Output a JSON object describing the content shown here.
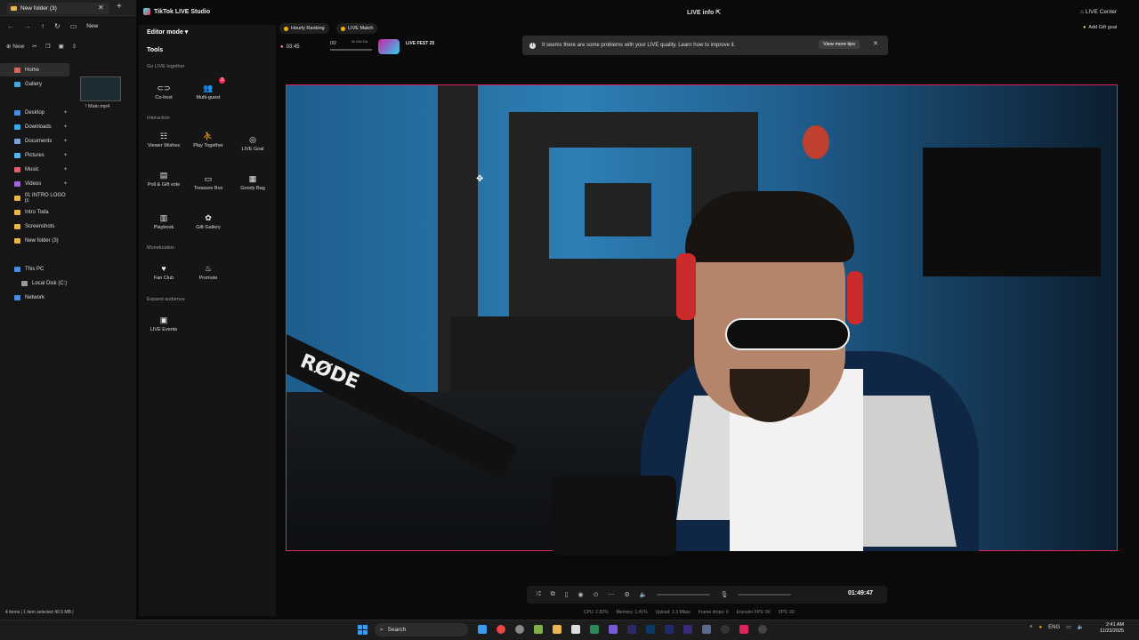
{
  "explorer": {
    "tab_title": "New folder (3)",
    "new_label": "New",
    "sidebar": [
      {
        "label": "Home",
        "color": "#cf6a5a"
      },
      {
        "label": "Gallery",
        "color": "#4aa3df"
      },
      {
        "label": "Desktop",
        "color": "#4a8de0"
      },
      {
        "label": "Downloads",
        "color": "#3fa9e8"
      },
      {
        "label": "Documents",
        "color": "#7aa4d9"
      },
      {
        "label": "Pictures",
        "color": "#59b5e8"
      },
      {
        "label": "Music",
        "color": "#e06070"
      },
      {
        "label": "Videos",
        "color": "#a066d9"
      },
      {
        "label": "01 INTRO LOGO (c",
        "color": "#e8b64c"
      },
      {
        "label": "Intro Toda",
        "color": "#e8b64c"
      },
      {
        "label": "Screenshots",
        "color": "#e8b64c"
      },
      {
        "label": "New folder (3)",
        "color": "#e8b64c"
      },
      {
        "label": "This PC",
        "color": "#4a8de0"
      },
      {
        "label": "Local Disk (C:)",
        "color": "#999999"
      },
      {
        "label": "Network",
        "color": "#4a8de0"
      }
    ],
    "file_name": "! Main.mp4",
    "status": "4 items  |  1 item selected  40.9 MB  |"
  },
  "studio": {
    "app_title": "TikTok LIVE Studio",
    "live_info": "LIVE info",
    "live_center": "LIVE Center",
    "editor_mode": "Editor mode",
    "tools_title": "Tools",
    "sections": {
      "go_live": "Go LIVE together",
      "interaction": "Interaction",
      "monetization": "Monetization",
      "expand": "Expand audience"
    },
    "tools": {
      "cohost": "Co-host",
      "multiguest": "Multi-guest",
      "multiguest_badge": "3",
      "viewer_wishes": "Viewer Wishes",
      "play_together": "Play Together",
      "live_goal": "LIVE Goal",
      "poll": "Poll & Gift vote",
      "treasure": "Treasure Box",
      "goody": "Goody Bag",
      "playbook": "Playbook",
      "gift_gallery": "Gift Gallery",
      "fan_club": "Fan Club",
      "promote": "Promote",
      "live_events": "LIVE Events"
    },
    "hourly_ranking": "Hourly Ranking",
    "live_match": "LIVE Match",
    "timer": "03:45",
    "match_count": "0/2",
    "match_small": "0h 10m 10s",
    "fest": "LIVE FEST 25",
    "warning": "It seems there are some problems with your LIVE quality. Learn how to improve it.",
    "view_more": "View more tips",
    "add_gift_goal": "Add Gift goal",
    "elapsed": "01:49:47",
    "stats": {
      "cpu": "CPU: 1.82%",
      "memory": "Memory: 1.41%",
      "upload": "Upload: 1.3 Mbps",
      "frame_drops": "Frame drops: 0",
      "encoder_fps": "Encoder FPS: 60",
      "fps": "FPS: 60"
    }
  },
  "taskbar": {
    "search": "Search",
    "lang": "ENG",
    "time": "2:41 AM",
    "date": "11/23/2025"
  }
}
